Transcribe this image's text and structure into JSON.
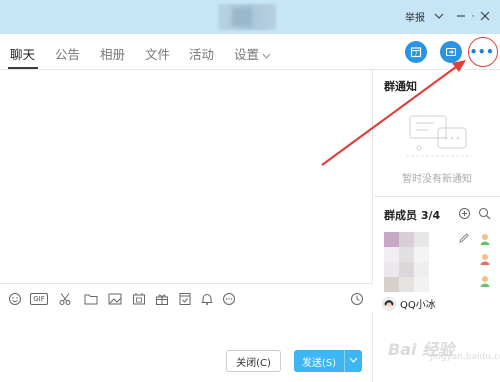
{
  "titlebar": {
    "report_label": "举报",
    "minimize_icon": "minimize-icon",
    "maximize_icon": "maximize-icon",
    "close_icon": "close-icon",
    "dropdown_icon": "chevron-down-icon",
    "background": "#c6e6f8"
  },
  "tabs": [
    {
      "label": "聊天",
      "active": true
    },
    {
      "label": "公告",
      "active": false
    },
    {
      "label": "相册",
      "active": false
    },
    {
      "label": "文件",
      "active": false
    },
    {
      "label": "活动",
      "active": false
    },
    {
      "label": "设置",
      "active": false
    }
  ],
  "tool_buttons": {
    "calendar_icon": "calendar-icon",
    "share_icon": "share-arrow-icon",
    "more_icon": "more-options-icon",
    "more_label": "•••",
    "accent": "#2a94e0"
  },
  "toolbar": {
    "icons": [
      "emoji-icon",
      "gif-icon",
      "scissors-icon",
      "folder-icon",
      "image-icon",
      "gift-icon",
      "calendar-icon",
      "bell-icon",
      "more-icon",
      "history-clock-icon"
    ],
    "gif_label": "GIF"
  },
  "buttons": {
    "close_label": "关闭(C)",
    "send_label": "发送(S)",
    "send_color": "#3eb5f5"
  },
  "right_panel": {
    "notice_title": "群通知",
    "notice_empty": "暂时没有新通知",
    "members_title": "群成员 3/4",
    "member_name": "QQ小冰"
  },
  "annotation": {
    "arrow_color": "#e0403b"
  },
  "watermark": {
    "text": "Bai 经验",
    "sub": "jingyan.baidu.com"
  }
}
